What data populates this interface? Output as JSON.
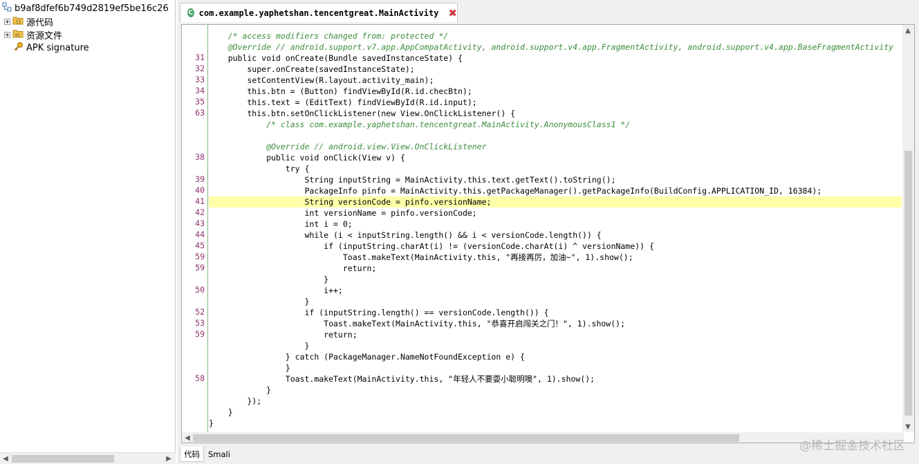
{
  "tree": {
    "root_label": "b9af8dfef6b749d2819ef5be16c26",
    "items": [
      {
        "label": "源代码"
      },
      {
        "label": "资源文件"
      },
      {
        "label": "APK signature"
      }
    ]
  },
  "editor": {
    "tab_title": "com.example.yaphetshan.tencentgreat.MainActivity",
    "class_icon_glyph": "C",
    "close_glyph": "✖",
    "line_numbers": [
      "31",
      "32",
      "33",
      "34",
      "35",
      "63",
      "38",
      "39",
      "40",
      "41",
      "42",
      "43",
      "44",
      "45",
      "59",
      "59",
      "50",
      "52",
      "53",
      "59",
      "58"
    ],
    "code_lines": [
      "    /* access modifiers changed from: protected */",
      "    @Override // android.support.v7.app.AppCompatActivity, android.support.v4.app.FragmentActivity, android.support.v4.app.BaseFragmentActivity",
      "    public void onCreate(Bundle savedInstanceState) {",
      "        super.onCreate(savedInstanceState);",
      "        setContentView(R.layout.activity_main);",
      "        this.btn = (Button) findViewById(R.id.checBtn);",
      "        this.text = (EditText) findViewById(R.id.input);",
      "        this.btn.setOnClickListener(new View.OnClickListener() {",
      "            /* class com.example.yaphetshan.tencentgreat.MainActivity.AnonymousClass1 */",
      "",
      "            @Override // android.view.View.OnClickListener",
      "            public void onClick(View v) {",
      "                try {",
      "                    String inputString = MainActivity.this.text.getText().toString();",
      "                    PackageInfo pinfo = MainActivity.this.getPackageManager().getPackageInfo(BuildConfig.APPLICATION_ID, 16384);",
      "                    String versionCode = pinfo.versionName;",
      "                    int versionName = pinfo.versionCode;",
      "                    int i = 0;",
      "                    while (i < inputString.length() && i < versionCode.length()) {",
      "                        if (inputString.charAt(i) != (versionCode.charAt(i) ^ versionName)) {",
      "                            Toast.makeText(MainActivity.this, \"再接再厉，加油~\", 1).show();",
      "                            return;",
      "                        }",
      "                        i++;",
      "                    }",
      "                    if (inputString.length() == versionCode.length()) {",
      "                        Toast.makeText(MainActivity.this, \"恭喜开启闯关之门！\", 1).show();",
      "                        return;",
      "                    }",
      "                } catch (PackageManager.NameNotFoundException e) {",
      "                }",
      "                Toast.makeText(MainActivity.this, \"年轻人不要耍小聪明噢\", 1).show();",
      "            }",
      "        });",
      "    }",
      "}"
    ]
  },
  "bottom_tabs": [
    {
      "label": "代码"
    },
    {
      "label": "Smali"
    }
  ],
  "watermark": "@稀土掘金技术社区"
}
